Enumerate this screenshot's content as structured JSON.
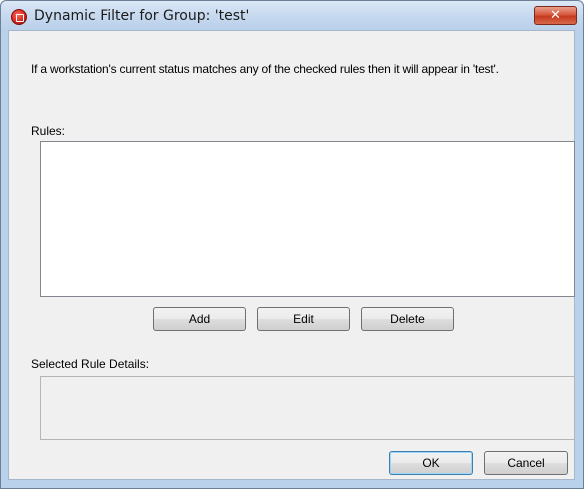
{
  "window": {
    "title": "Dynamic Filter for Group: 'test'",
    "close_label": "✕"
  },
  "dialog": {
    "description": "If a workstation's current status matches any of the checked rules then it will appear in 'test'.",
    "rules_label": "Rules:",
    "rules": [],
    "add_label": "Add",
    "edit_label": "Edit",
    "delete_label": "Delete",
    "details_label": "Selected Rule Details:",
    "details_value": "",
    "ok_label": "OK",
    "cancel_label": "Cancel"
  },
  "colors": {
    "client_background": "#f0f0f0",
    "close_button": "#c43a1e",
    "app_icon": "#d0241a"
  },
  "icons": {
    "app": "app-icon",
    "close": "close-icon"
  }
}
